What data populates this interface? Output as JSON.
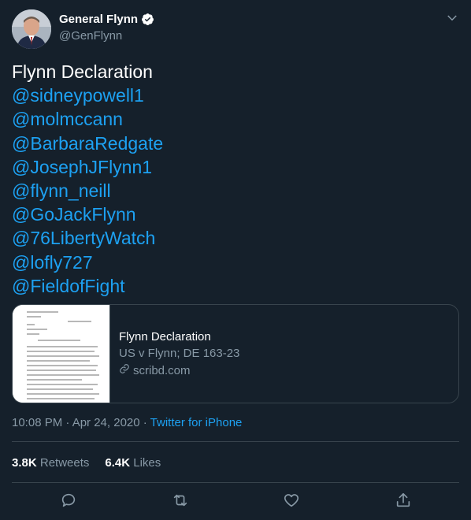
{
  "author": {
    "display_name": "General Flynn",
    "handle": "@GenFlynn"
  },
  "tweet": {
    "lines": [
      "Flynn Declaration",
      "@sidneypowell1",
      "@molmccann",
      "@BarbaraRedgate",
      "@JosephJFlynn1",
      "@flynn_neill",
      "@GoJackFlynn",
      "@76LibertyWatch",
      "@lofly727",
      "@FieldofFight"
    ]
  },
  "card": {
    "title": "Flynn Declaration",
    "description": "US v Flynn; DE 163-23",
    "site": "scribd.com"
  },
  "meta": {
    "time": "10:08 PM · Apr 24, 2020 · ",
    "source": "Twitter for iPhone"
  },
  "stats": {
    "retweets_count": "3.8K",
    "retweets_label": "Retweets",
    "likes_count": "6.4K",
    "likes_label": "Likes"
  },
  "colors": {
    "background": "#15202b",
    "accent": "#1da1f2",
    "secondary_text": "#8899a6",
    "border": "#38444d"
  },
  "icons": [
    "verified-badge-icon",
    "chevron-down-icon",
    "link-icon",
    "reply-icon",
    "retweet-icon",
    "like-icon",
    "share-icon"
  ]
}
